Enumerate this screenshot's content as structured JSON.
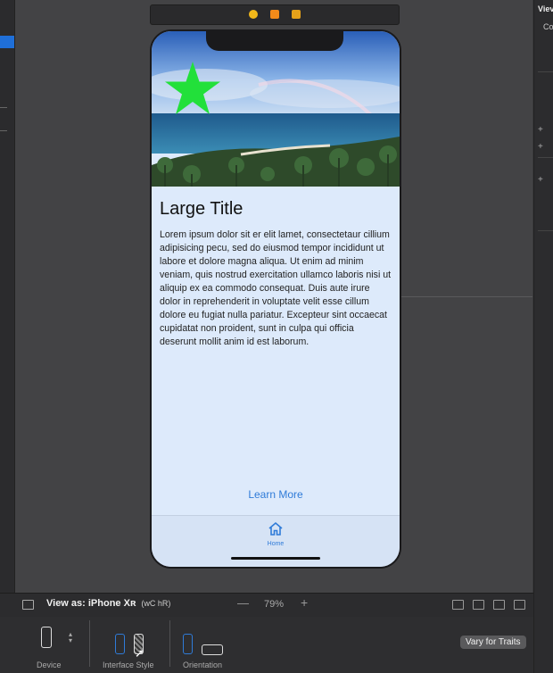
{
  "canvas": {
    "scene": {
      "large_title": "Large Title",
      "body_text": "Lorem ipsum dolor sit er elit lamet, consectetaur cillium adipisicing pecu, sed do eiusmod tempor incididunt ut labore et dolore magna aliqua. Ut enim ad minim veniam, quis nostrud exercitation ullamco laboris nisi ut aliquip ex ea commodo consequat. Duis aute irure dolor in reprehenderit in voluptate velit esse cillum dolore eu fugiat nulla pariatur. Excepteur sint occaecat cupidatat non proident, sunt in culpa qui officia deserunt mollit anim id est laborum.",
      "learn_more_label": "Learn More",
      "tab_home_label": "Home",
      "star_color": "#22e03a",
      "accent_color": "#2f7bd8"
    }
  },
  "bottom_bar": {
    "view_as_label": "View as: iPhone Xʀ",
    "size_class": "(wC hR)",
    "zoom_minus": "—",
    "zoom": "79%",
    "zoom_plus": "+"
  },
  "traits": {
    "device_label": "Device",
    "interface_style_label": "Interface Style",
    "orientation_label": "Orientation",
    "vary_button_label": "Vary for Traits"
  },
  "inspector": {
    "title": "Viev",
    "subtitle": "Co"
  }
}
